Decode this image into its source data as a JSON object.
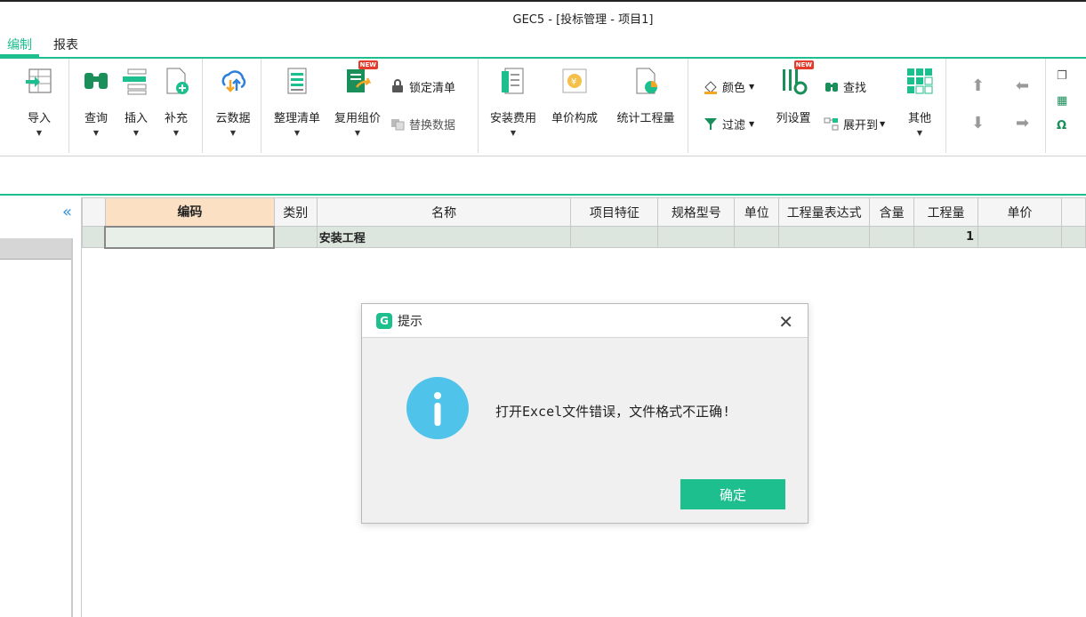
{
  "window": {
    "title": "GEC5 - [投标管理 - 项目1]"
  },
  "menu": {
    "tabs": [
      "编制",
      "报表"
    ]
  },
  "ribbon": {
    "import": "导入",
    "query": "查询",
    "insert": "插入",
    "supplement": "补充",
    "cloud": "云数据",
    "tidy": "整理清单",
    "reuse": "复用组价",
    "reuse_badge": "NEW",
    "lock": "锁定清单",
    "replace": "替换数据",
    "install_fee": "安装费用",
    "unit_price": "单价构成",
    "stats": "统计工程量",
    "color": "颜色",
    "filter": "过滤",
    "colset": "列设置",
    "colset_badge": "NEW",
    "find": "查找",
    "expand": "展开到",
    "other": "其他"
  },
  "table": {
    "headers": [
      "编码",
      "类别",
      "名称",
      "项目特征",
      "规格型号",
      "单位",
      "工程量表达式",
      "含量",
      "工程量",
      "单价"
    ],
    "rows": [
      {
        "code": "",
        "type": "",
        "name": "安装工程",
        "feature": "",
        "model": "",
        "unit": "",
        "expr": "",
        "content": "",
        "qty": "1",
        "price": ""
      }
    ]
  },
  "left": {
    "collapse_icon": "«"
  },
  "dialog": {
    "logo": "G",
    "title": "提示",
    "message": "打开Excel文件错误，文件格式不正确!",
    "ok": "确定",
    "close": "✕",
    "info_glyph": "i"
  }
}
